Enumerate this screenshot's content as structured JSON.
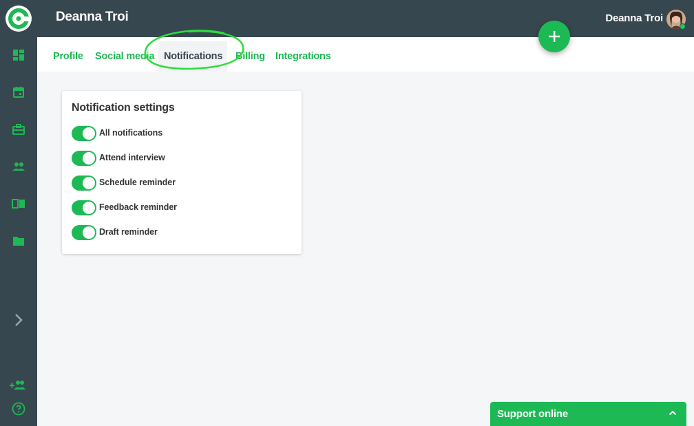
{
  "header": {
    "title": "Deanna Troi",
    "user_name": "Deanna Troi"
  },
  "sidebar": {
    "items": [
      {
        "icon": "dashboard-icon"
      },
      {
        "icon": "calendar-icon"
      },
      {
        "icon": "briefcase-icon"
      },
      {
        "icon": "people-icon"
      },
      {
        "icon": "book-icon"
      },
      {
        "icon": "folder-icon"
      }
    ],
    "expand_icon": "chevron-right-icon",
    "add_user_icon": "add-user-icon",
    "help_icon": "help-icon"
  },
  "tabs": [
    {
      "label": "Profile"
    },
    {
      "label": "Social media"
    },
    {
      "label": "Notifications",
      "active": true
    },
    {
      "label": "Billing"
    },
    {
      "label": "Integrations"
    }
  ],
  "notifications": {
    "title": "Notification settings",
    "settings": [
      {
        "label": "All notifications",
        "enabled": true
      },
      {
        "label": "Attend interview",
        "enabled": true
      },
      {
        "label": "Schedule reminder",
        "enabled": true
      },
      {
        "label": "Feedback reminder",
        "enabled": true
      },
      {
        "label": "Draft reminder",
        "enabled": true
      }
    ]
  },
  "support": {
    "label": "Support online"
  },
  "colors": {
    "accent": "#1db954",
    "sidebar": "#37474f",
    "background": "#f5f6f8"
  }
}
